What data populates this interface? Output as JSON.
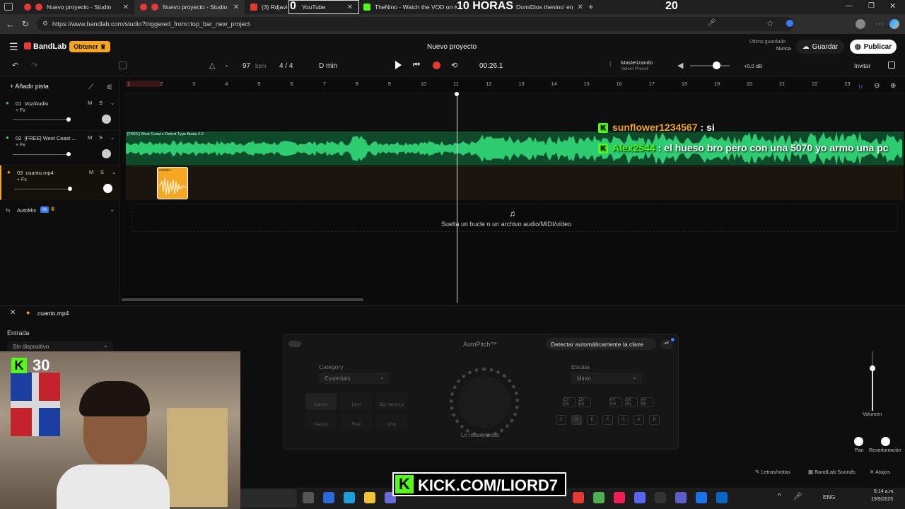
{
  "browser": {
    "tabs": [
      {
        "label": "Nuevo proyecto - Studio",
        "active": false
      },
      {
        "label": "Nuevo proyecto - Studio",
        "active": true
      },
      {
        "label": "(3) Rdjavi",
        "active": false
      },
      {
        "label": "YouTube",
        "active": false
      },
      {
        "label": "TheNino - Watch the VOD on Kick",
        "active": false
      },
      {
        "label": "DomiDios thenino' en",
        "active": false
      }
    ],
    "url": "https://www.bandlab.com/studio?triggered_from=top_bar_new_project"
  },
  "overlay": {
    "timer_left": "0",
    "title": "10 HORAS",
    "timer_right": "20",
    "cam_badge_count": "30",
    "kick_url": "KICK.COM/LIORD7",
    "chat": [
      {
        "user": "sunflower1234567",
        "msg": " : si"
      },
      {
        "user": "Alex2544",
        "msg": " : el hueso bro pero con una 5070 yo armo una pc"
      }
    ]
  },
  "app": {
    "brand": "BandLab",
    "upgrade_label": "Obtener",
    "project_title": "Nuevo proyecto",
    "saved_label": "Último guardado",
    "saved_value": "Nunca",
    "save_button": "Guardar",
    "publish_button": "Publicar",
    "bpm": "97",
    "bpm_unit": "bpm",
    "time_sig": "4 / 4",
    "key": "D min",
    "time": "00:26.1",
    "mastering_title": "Masterizando",
    "mastering_sub": "Select Preset",
    "volume_db": "+0.0 dB",
    "invite": "Invitar",
    "add_track": "Añadir pista",
    "tracks": [
      {
        "num": "01",
        "name": "Voz/Audio",
        "fx": "+ Fx",
        "m": "M",
        "s": "S"
      },
      {
        "num": "02",
        "name": "[FREE] West Coast ...",
        "fx": "+ Fx",
        "m": "M",
        "s": "S"
      },
      {
        "num": "03",
        "name": "cuanto.mp4",
        "fx": "+ Fx",
        "m": "M",
        "s": "S"
      }
    ],
    "automix": "AutoMix",
    "automix_badge": "IA",
    "ruler": [
      "1",
      "2",
      "3",
      "4",
      "5",
      "6",
      "7",
      "8",
      "9",
      "10",
      "11",
      "12",
      "13",
      "14",
      "15",
      "16",
      "17",
      "18",
      "19",
      "20",
      "21",
      "22",
      "23"
    ],
    "clip_label": "[FREE] West Coast x Detroit Type Beats 2.0",
    "clip3_label": "cuanto...",
    "drop_hint": "Suelta un bucle o un archivo audio/MIDI/vídeo"
  },
  "panel": {
    "track_name": "cuanto.mp4",
    "entrada": "Entrada",
    "device": "Sin dispositivo",
    "autopitch_title": "AutoPitch™",
    "detect_key": "Detectar automáticamente la clave",
    "category_label": "Category",
    "category_value": "Essentials",
    "presets": [
      "Classic",
      "Duet",
      "Big Harmony",
      "Natural",
      "Float",
      "Chip"
    ],
    "knob_caption": "Lo más intenso",
    "scale_label": "Escala",
    "scale_value": "Minor",
    "sharps": [
      "C# Db",
      "D# Eb",
      "F# Gb",
      "G# Ab",
      "A# Bb"
    ],
    "naturals": [
      "C",
      "D",
      "E",
      "F",
      "G",
      "A",
      "B"
    ],
    "volume_label": "Volumen",
    "pan_label": "Pan",
    "reverb_label": "Reverberación",
    "footer": [
      "Letras/notas",
      "BandLab Sounds",
      "Atajos"
    ]
  },
  "taskbar": {
    "lang": "ENG",
    "time": "6:14 a.m.",
    "date": "19/9/2025"
  },
  "colors": {
    "accent_orange": "#f5a623",
    "wave_green": "#2ecc71",
    "kick_green": "#53fc18",
    "record_red": "#e53935"
  }
}
